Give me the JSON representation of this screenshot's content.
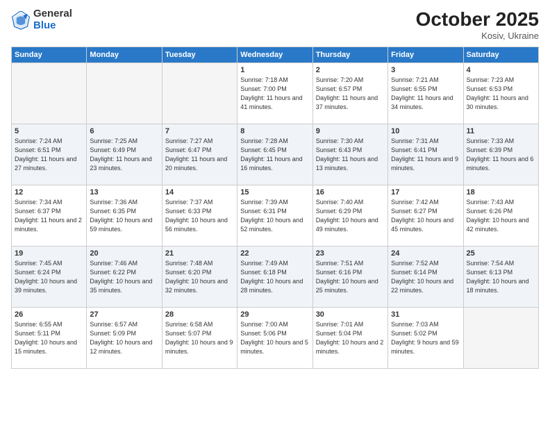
{
  "header": {
    "logo_general": "General",
    "logo_blue": "Blue",
    "month_title": "October 2025",
    "location": "Kosiv, Ukraine"
  },
  "days_of_week": [
    "Sunday",
    "Monday",
    "Tuesday",
    "Wednesday",
    "Thursday",
    "Friday",
    "Saturday"
  ],
  "weeks": [
    [
      {
        "day": "",
        "info": ""
      },
      {
        "day": "",
        "info": ""
      },
      {
        "day": "",
        "info": ""
      },
      {
        "day": "1",
        "info": "Sunrise: 7:18 AM\nSunset: 7:00 PM\nDaylight: 11 hours and 41 minutes."
      },
      {
        "day": "2",
        "info": "Sunrise: 7:20 AM\nSunset: 6:57 PM\nDaylight: 11 hours and 37 minutes."
      },
      {
        "day": "3",
        "info": "Sunrise: 7:21 AM\nSunset: 6:55 PM\nDaylight: 11 hours and 34 minutes."
      },
      {
        "day": "4",
        "info": "Sunrise: 7:23 AM\nSunset: 6:53 PM\nDaylight: 11 hours and 30 minutes."
      }
    ],
    [
      {
        "day": "5",
        "info": "Sunrise: 7:24 AM\nSunset: 6:51 PM\nDaylight: 11 hours and 27 minutes."
      },
      {
        "day": "6",
        "info": "Sunrise: 7:25 AM\nSunset: 6:49 PM\nDaylight: 11 hours and 23 minutes."
      },
      {
        "day": "7",
        "info": "Sunrise: 7:27 AM\nSunset: 6:47 PM\nDaylight: 11 hours and 20 minutes."
      },
      {
        "day": "8",
        "info": "Sunrise: 7:28 AM\nSunset: 6:45 PM\nDaylight: 11 hours and 16 minutes."
      },
      {
        "day": "9",
        "info": "Sunrise: 7:30 AM\nSunset: 6:43 PM\nDaylight: 11 hours and 13 minutes."
      },
      {
        "day": "10",
        "info": "Sunrise: 7:31 AM\nSunset: 6:41 PM\nDaylight: 11 hours and 9 minutes."
      },
      {
        "day": "11",
        "info": "Sunrise: 7:33 AM\nSunset: 6:39 PM\nDaylight: 11 hours and 6 minutes."
      }
    ],
    [
      {
        "day": "12",
        "info": "Sunrise: 7:34 AM\nSunset: 6:37 PM\nDaylight: 11 hours and 2 minutes."
      },
      {
        "day": "13",
        "info": "Sunrise: 7:36 AM\nSunset: 6:35 PM\nDaylight: 10 hours and 59 minutes."
      },
      {
        "day": "14",
        "info": "Sunrise: 7:37 AM\nSunset: 6:33 PM\nDaylight: 10 hours and 56 minutes."
      },
      {
        "day": "15",
        "info": "Sunrise: 7:39 AM\nSunset: 6:31 PM\nDaylight: 10 hours and 52 minutes."
      },
      {
        "day": "16",
        "info": "Sunrise: 7:40 AM\nSunset: 6:29 PM\nDaylight: 10 hours and 49 minutes."
      },
      {
        "day": "17",
        "info": "Sunrise: 7:42 AM\nSunset: 6:27 PM\nDaylight: 10 hours and 45 minutes."
      },
      {
        "day": "18",
        "info": "Sunrise: 7:43 AM\nSunset: 6:26 PM\nDaylight: 10 hours and 42 minutes."
      }
    ],
    [
      {
        "day": "19",
        "info": "Sunrise: 7:45 AM\nSunset: 6:24 PM\nDaylight: 10 hours and 39 minutes."
      },
      {
        "day": "20",
        "info": "Sunrise: 7:46 AM\nSunset: 6:22 PM\nDaylight: 10 hours and 35 minutes."
      },
      {
        "day": "21",
        "info": "Sunrise: 7:48 AM\nSunset: 6:20 PM\nDaylight: 10 hours and 32 minutes."
      },
      {
        "day": "22",
        "info": "Sunrise: 7:49 AM\nSunset: 6:18 PM\nDaylight: 10 hours and 28 minutes."
      },
      {
        "day": "23",
        "info": "Sunrise: 7:51 AM\nSunset: 6:16 PM\nDaylight: 10 hours and 25 minutes."
      },
      {
        "day": "24",
        "info": "Sunrise: 7:52 AM\nSunset: 6:14 PM\nDaylight: 10 hours and 22 minutes."
      },
      {
        "day": "25",
        "info": "Sunrise: 7:54 AM\nSunset: 6:13 PM\nDaylight: 10 hours and 18 minutes."
      }
    ],
    [
      {
        "day": "26",
        "info": "Sunrise: 6:55 AM\nSunset: 5:11 PM\nDaylight: 10 hours and 15 minutes."
      },
      {
        "day": "27",
        "info": "Sunrise: 6:57 AM\nSunset: 5:09 PM\nDaylight: 10 hours and 12 minutes."
      },
      {
        "day": "28",
        "info": "Sunrise: 6:58 AM\nSunset: 5:07 PM\nDaylight: 10 hours and 9 minutes."
      },
      {
        "day": "29",
        "info": "Sunrise: 7:00 AM\nSunset: 5:06 PM\nDaylight: 10 hours and 5 minutes."
      },
      {
        "day": "30",
        "info": "Sunrise: 7:01 AM\nSunset: 5:04 PM\nDaylight: 10 hours and 2 minutes."
      },
      {
        "day": "31",
        "info": "Sunrise: 7:03 AM\nSunset: 5:02 PM\nDaylight: 9 hours and 59 minutes."
      },
      {
        "day": "",
        "info": ""
      }
    ]
  ]
}
